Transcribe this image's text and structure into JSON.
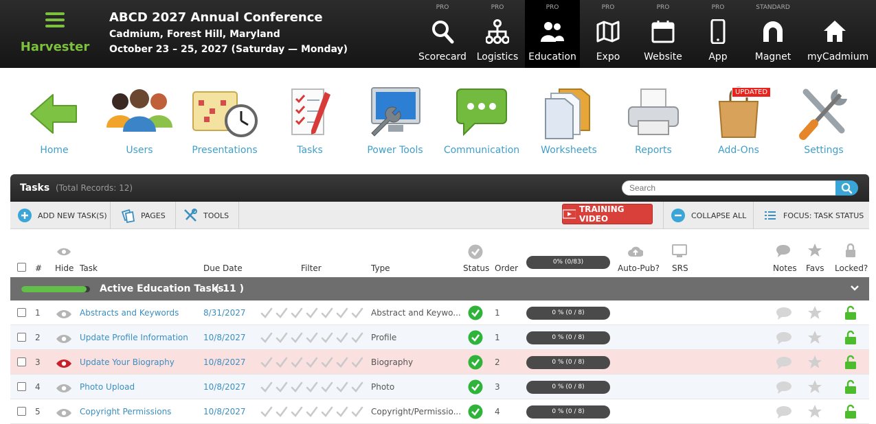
{
  "header": {
    "brand": "Harvester",
    "event_title": "ABCD 2027 Annual Conference",
    "event_location": "Cadmium, Forest Hill, Maryland",
    "event_dates": "October 23 – 25, 2027 (Saturday — Monday)",
    "modules": [
      {
        "tier": "PRO",
        "label": "Scorecard",
        "icon": "search-icon",
        "active": false
      },
      {
        "tier": "PRO",
        "label": "Logistics",
        "icon": "sitemap-icon",
        "active": false
      },
      {
        "tier": "PRO",
        "label": "Education",
        "icon": "users-icon",
        "active": true
      },
      {
        "tier": "PRO",
        "label": "Expo",
        "icon": "map-icon",
        "active": false
      },
      {
        "tier": "PRO",
        "label": "Website",
        "icon": "calendar-icon",
        "active": false
      },
      {
        "tier": "PRO",
        "label": "App",
        "icon": "phone-icon",
        "active": false
      },
      {
        "tier": "STANDARD",
        "label": "Magnet",
        "icon": "magnet-icon",
        "active": false
      },
      {
        "tier": "",
        "label": "myCadmium",
        "icon": "home-icon",
        "active": false
      }
    ]
  },
  "toolbar": {
    "items": [
      {
        "label": "Home",
        "icon": "back-arrow-icon"
      },
      {
        "label": "Users",
        "icon": "people-icon"
      },
      {
        "label": "Presentations",
        "icon": "calendar-clock-icon"
      },
      {
        "label": "Tasks",
        "icon": "checklist-icon"
      },
      {
        "label": "Power Tools",
        "icon": "monitor-wrench-icon"
      },
      {
        "label": "Communication",
        "icon": "chat-bubble-icon"
      },
      {
        "label": "Worksheets",
        "icon": "folder-icon"
      },
      {
        "label": "Reports",
        "icon": "printer-icon"
      },
      {
        "label": "Add-Ons",
        "icon": "shopping-bag-icon"
      },
      {
        "label": "Settings",
        "icon": "tools-icon"
      }
    ],
    "updated_badge": "UPDATED"
  },
  "panel": {
    "title": "Tasks",
    "record_count": "(Total Records: 12)",
    "search_placeholder": "Search",
    "actions": {
      "add": "ADD NEW TASK(S)",
      "pages": "PAGES",
      "tools": "TOOLS",
      "training": "TRAINING VIDEO",
      "collapse": "COLLAPSE ALL",
      "focus": "FOCUS: TASK STATUS"
    }
  },
  "columns": {
    "num": "#",
    "hide": "Hide",
    "task": "Task",
    "due": "Due Date",
    "filter": "Filter",
    "type": "Type",
    "status": "Status",
    "order": "Order",
    "progress": "0% (0/83)",
    "autopub": "Auto-Pub?",
    "srs": "SRS",
    "notes": "Notes",
    "favs": "Favs",
    "locked": "Locked?"
  },
  "group": {
    "title": "Active Education Tasks",
    "count": "( 11 )",
    "progress_fraction": 0.95
  },
  "tasks": [
    {
      "num": "1",
      "task": "Abstracts and Keywords",
      "due": "8/31/2027",
      "type": "Abstract and Keywo...",
      "order": "1",
      "progress": "0 % (0 / 8)",
      "hidden": false,
      "highlight": false
    },
    {
      "num": "2",
      "task": "Update Profile Information",
      "due": "10/8/2027",
      "type": "Profile",
      "order": "1",
      "progress": "0 % (0 / 8)",
      "hidden": false,
      "highlight": false
    },
    {
      "num": "3",
      "task": "Update Your Biography",
      "due": "10/8/2027",
      "type": "Biography",
      "order": "2",
      "progress": "0 % (0 / 8)",
      "hidden": true,
      "highlight": true
    },
    {
      "num": "4",
      "task": "Photo Upload",
      "due": "10/8/2027",
      "type": "Photo",
      "order": "3",
      "progress": "0 % (0 / 8)",
      "hidden": false,
      "highlight": false
    },
    {
      "num": "5",
      "task": "Copyright Permissions",
      "due": "10/8/2027",
      "type": "Copyright/Permissio...",
      "order": "4",
      "progress": "0 % (0 / 8)",
      "hidden": false,
      "highlight": false
    }
  ],
  "colors": {
    "brand_green": "#7cc03e",
    "link_blue": "#3a8ec0",
    "status_green": "#2fb33a",
    "highlight_row": "#fbe0e0",
    "alt_row": "#f3f7fc",
    "training_red": "#d9403a",
    "lock_green": "#4cbb2c"
  }
}
